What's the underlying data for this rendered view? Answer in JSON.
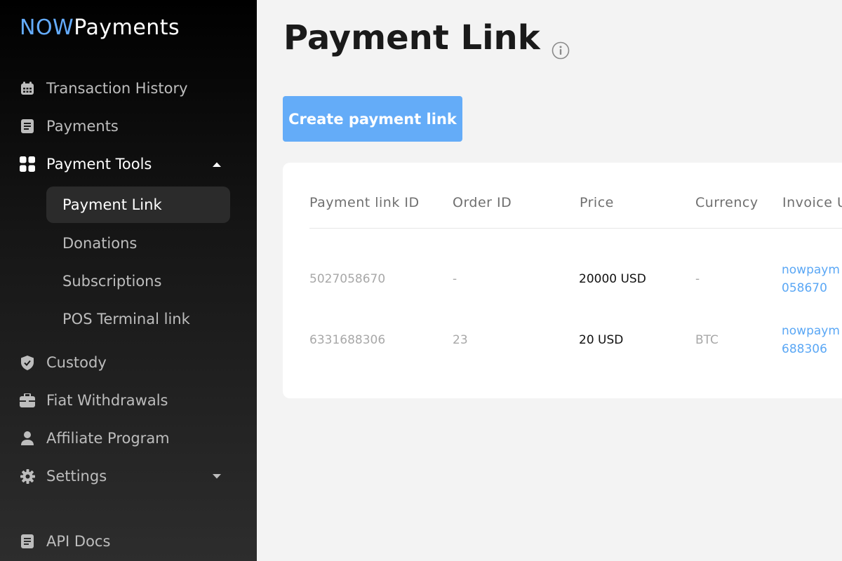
{
  "brand": {
    "now": "NOW",
    "payments": "Payments",
    "accent": "#64acff"
  },
  "sidebar": {
    "items": [
      {
        "label": "Transaction History",
        "icon": "calendar-icon"
      },
      {
        "label": "Payments",
        "icon": "document-icon"
      },
      {
        "label": "Payment Tools",
        "icon": "grid-icon",
        "expanded": true
      },
      {
        "label": "Custody",
        "icon": "shield-icon"
      },
      {
        "label": "Fiat Withdrawals",
        "icon": "briefcase-icon"
      },
      {
        "label": "Affiliate Program",
        "icon": "user-icon"
      },
      {
        "label": "Settings",
        "icon": "gear-icon",
        "expanded": false
      },
      {
        "label": "API Docs",
        "icon": "document-icon"
      }
    ],
    "subitems": [
      {
        "label": "Payment Link",
        "active": true
      },
      {
        "label": "Donations"
      },
      {
        "label": "Subscriptions"
      },
      {
        "label": "POS Terminal link"
      }
    ]
  },
  "main": {
    "title": "Payment Link",
    "create_button": "Create payment link",
    "table": {
      "headers": [
        "Payment link ID",
        "Order ID",
        "Price",
        "Currency",
        "Invoice U"
      ],
      "rows": [
        {
          "id": "5027058670",
          "order": "-",
          "price": "20000 USD",
          "currency": "-",
          "invoice_line1": "nowpaym",
          "invoice_line2": "058670"
        },
        {
          "id": "6331688306",
          "order": "23",
          "price": "20 USD",
          "currency": "BTC",
          "invoice_line1": "nowpaym",
          "invoice_line2": "688306"
        }
      ]
    }
  },
  "colors": {
    "button": "#64acf8",
    "link": "#5aa7f5",
    "sidebar_top": "#000000",
    "sidebar_bottom": "#2d2d2d"
  }
}
